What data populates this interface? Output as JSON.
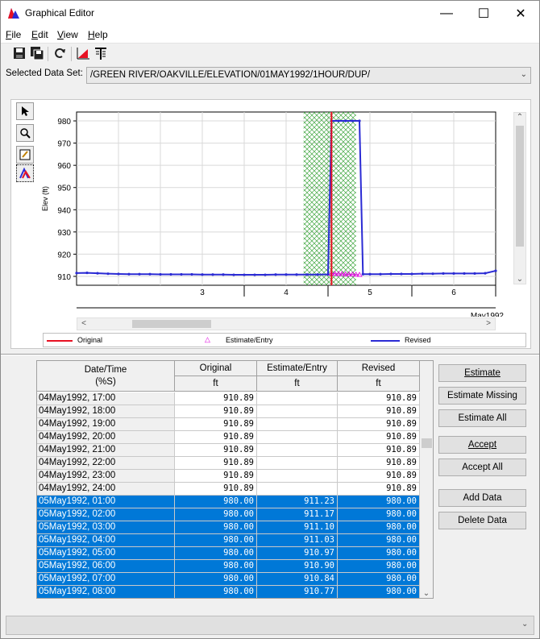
{
  "window": {
    "title": "Graphical Editor",
    "minimize": "—",
    "maximize": "☐",
    "close": "✕"
  },
  "menu": [
    {
      "key": "F",
      "rest": "ile"
    },
    {
      "key": "E",
      "rest": "dit"
    },
    {
      "key": "V",
      "rest": "iew"
    },
    {
      "key": "H",
      "rest": "elp"
    }
  ],
  "toolbar": [
    "save-icon",
    "save-as-icon",
    "refresh-icon",
    "plot-icon",
    "table-icon"
  ],
  "dataset": {
    "label": "Selected Data Set:",
    "value": "/GREEN RIVER/OAKVILLE/ELEVATION/01MAY1992/1HOUR/DUP/"
  },
  "plot_tools": [
    "pointer-icon",
    "zoom-icon",
    "edit-icon",
    "draw-icon"
  ],
  "chart_data": {
    "type": "line",
    "ylabel": "Elev (ft)",
    "ylim": [
      906,
      984
    ],
    "yticks": [
      910,
      920,
      930,
      940,
      950,
      960,
      970,
      980
    ],
    "xlim": [
      0,
      120
    ],
    "x_tick_labels": [
      "3",
      "4",
      "5",
      "6"
    ],
    "x_day_ticks": [
      48,
      72,
      96,
      120
    ],
    "x_unit": "May1992",
    "cursor_x": 73,
    "highlight_x": [
      65,
      80
    ],
    "series": [
      {
        "name": "Original",
        "color": "#e81123",
        "x": [
          73,
          73
        ],
        "y": [
          910.89,
          980
        ]
      },
      {
        "name": "Estimate/Entry",
        "color": "#e000e0",
        "x": [
          73,
          74,
          75,
          76,
          77,
          78,
          79,
          80,
          81
        ],
        "y": [
          911.23,
          911.17,
          911.1,
          911.03,
          910.97,
          910.9,
          910.84,
          910.77,
          910.7
        ]
      },
      {
        "name": "Revised",
        "color": "#2b2bd4",
        "x": [
          0,
          3,
          6,
          9,
          12,
          15,
          18,
          21,
          24,
          27,
          30,
          33,
          36,
          39,
          42,
          45,
          48,
          51,
          54,
          57,
          60,
          63,
          66,
          69,
          72,
          73,
          75,
          77,
          79,
          81,
          82,
          84,
          87,
          90,
          93,
          96,
          99,
          102,
          105,
          108,
          111,
          114,
          117,
          120
        ],
        "y": [
          911.5,
          911.6,
          911.4,
          911.2,
          911.1,
          911.0,
          911.0,
          911.0,
          910.9,
          910.9,
          910.9,
          910.9,
          910.8,
          910.8,
          910.8,
          910.7,
          910.7,
          910.7,
          910.7,
          910.8,
          910.8,
          910.8,
          910.8,
          910.8,
          910.9,
          980.0,
          980.0,
          980.0,
          980.0,
          980.0,
          911.0,
          911.0,
          911.0,
          911.1,
          911.1,
          911.1,
          911.2,
          911.2,
          911.3,
          911.3,
          911.3,
          911.3,
          911.4,
          912.5
        ]
      }
    ]
  },
  "legend": [
    "Original",
    "Estimate/Entry",
    "Revised"
  ],
  "table": {
    "headers": {
      "date": "Date/Time",
      "date_sub": "(%S)",
      "original": "Original",
      "estimate": "Estimate/Entry",
      "revised": "Revised",
      "unit": "ft"
    },
    "rows": [
      {
        "date": "04May1992, 17:00",
        "original": "910.89",
        "estimate": "",
        "revised": "910.89",
        "selected": false
      },
      {
        "date": "04May1992, 18:00",
        "original": "910.89",
        "estimate": "",
        "revised": "910.89",
        "selected": false
      },
      {
        "date": "04May1992, 19:00",
        "original": "910.89",
        "estimate": "",
        "revised": "910.89",
        "selected": false
      },
      {
        "date": "04May1992, 20:00",
        "original": "910.89",
        "estimate": "",
        "revised": "910.89",
        "selected": false
      },
      {
        "date": "04May1992, 21:00",
        "original": "910.89",
        "estimate": "",
        "revised": "910.89",
        "selected": false
      },
      {
        "date": "04May1992, 22:00",
        "original": "910.89",
        "estimate": "",
        "revised": "910.89",
        "selected": false
      },
      {
        "date": "04May1992, 23:00",
        "original": "910.89",
        "estimate": "",
        "revised": "910.89",
        "selected": false
      },
      {
        "date": "04May1992, 24:00",
        "original": "910.89",
        "estimate": "",
        "revised": "910.89",
        "selected": false
      },
      {
        "date": "05May1992, 01:00",
        "original": "980.00",
        "estimate": "911.23",
        "revised": "980.00",
        "selected": true
      },
      {
        "date": "05May1992, 02:00",
        "original": "980.00",
        "estimate": "911.17",
        "revised": "980.00",
        "selected": true
      },
      {
        "date": "05May1992, 03:00",
        "original": "980.00",
        "estimate": "911.10",
        "revised": "980.00",
        "selected": true
      },
      {
        "date": "05May1992, 04:00",
        "original": "980.00",
        "estimate": "911.03",
        "revised": "980.00",
        "selected": true
      },
      {
        "date": "05May1992, 05:00",
        "original": "980.00",
        "estimate": "910.97",
        "revised": "980.00",
        "selected": true
      },
      {
        "date": "05May1992, 06:00",
        "original": "980.00",
        "estimate": "910.90",
        "revised": "980.00",
        "selected": true
      },
      {
        "date": "05May1992, 07:00",
        "original": "980.00",
        "estimate": "910.84",
        "revised": "980.00",
        "selected": true
      },
      {
        "date": "05May1992, 08:00",
        "original": "980.00",
        "estimate": "910.77",
        "revised": "980.00",
        "selected": true
      }
    ]
  },
  "buttons": [
    {
      "name": "estimate-button",
      "text": "Estimate",
      "u": true
    },
    {
      "name": "estimate-missing-button",
      "text": "Estimate Missing",
      "u": false
    },
    {
      "name": "estimate-all-button",
      "text": "Estimate All",
      "u": false
    },
    {
      "name": "accept-button",
      "text": "Accept",
      "u": true
    },
    {
      "name": "accept-all-button",
      "text": "Accept All",
      "u": false
    },
    {
      "name": "add-data-button",
      "text": "Add Data",
      "u": false
    },
    {
      "name": "delete-data-button",
      "text": "Delete Data",
      "u": false
    }
  ],
  "colors": {
    "selection": "#0078d7",
    "original": "#e81123",
    "estimate": "#e000e0",
    "revised": "#2b2bd4",
    "highlight": "#2e9e2e"
  }
}
